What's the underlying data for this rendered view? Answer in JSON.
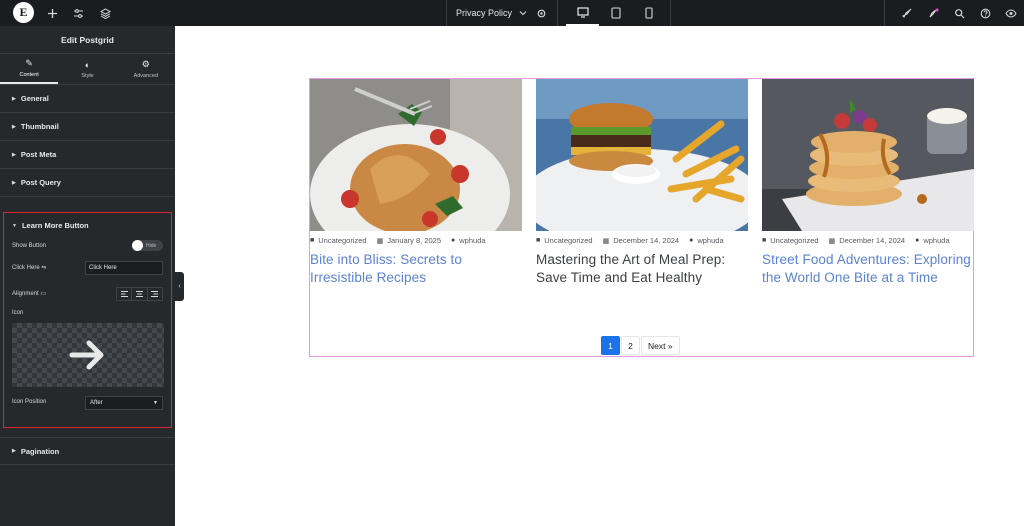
{
  "topbar": {
    "logo": "E",
    "page_select": "Privacy Policy"
  },
  "sidebar": {
    "title": "Edit Postgrid",
    "tabs": [
      {
        "label": "Content",
        "icon": "pencil-icon"
      },
      {
        "label": "Style",
        "icon": "half-circle-icon"
      },
      {
        "label": "Advanced",
        "icon": "gear-icon"
      }
    ],
    "sections": [
      "General",
      "Thumbnail",
      "Post Meta",
      "Post Query"
    ],
    "learn_more": {
      "title": "Learn More Button",
      "show_button_label": "Show Button",
      "toggle_text": "Hide",
      "click_here_label": "Click Here",
      "click_here_value": "Click Here",
      "alignment_label": "Alignment",
      "icon_label": "Icon",
      "icon_position_label": "Icon Position",
      "icon_position_value": "After"
    },
    "pagination_section": "Pagination"
  },
  "posts": [
    {
      "category": "Uncategorized",
      "date": "January 8, 2025",
      "author": "wphuda",
      "title": "Bite into Bliss: Secrets to Irresistible Recipes"
    },
    {
      "category": "Uncategorized",
      "date": "December 14, 2024",
      "author": "wphuda",
      "title": "Mastering the Art of Meal Prep: Save Time and Eat Healthy"
    },
    {
      "category": "Uncategorized",
      "date": "December 14, 2024",
      "author": "wphuda",
      "title": "Street Food Adventures: Exploring the World One Bite at a Time"
    }
  ],
  "pagination": {
    "pages": [
      "1",
      "2"
    ],
    "current": "1",
    "next": "Next »"
  },
  "colors": {
    "accent": "#1a73e8",
    "link": "#5b82d6",
    "selection_border": "#d9282f",
    "widget_outline": "#e39ce0"
  }
}
